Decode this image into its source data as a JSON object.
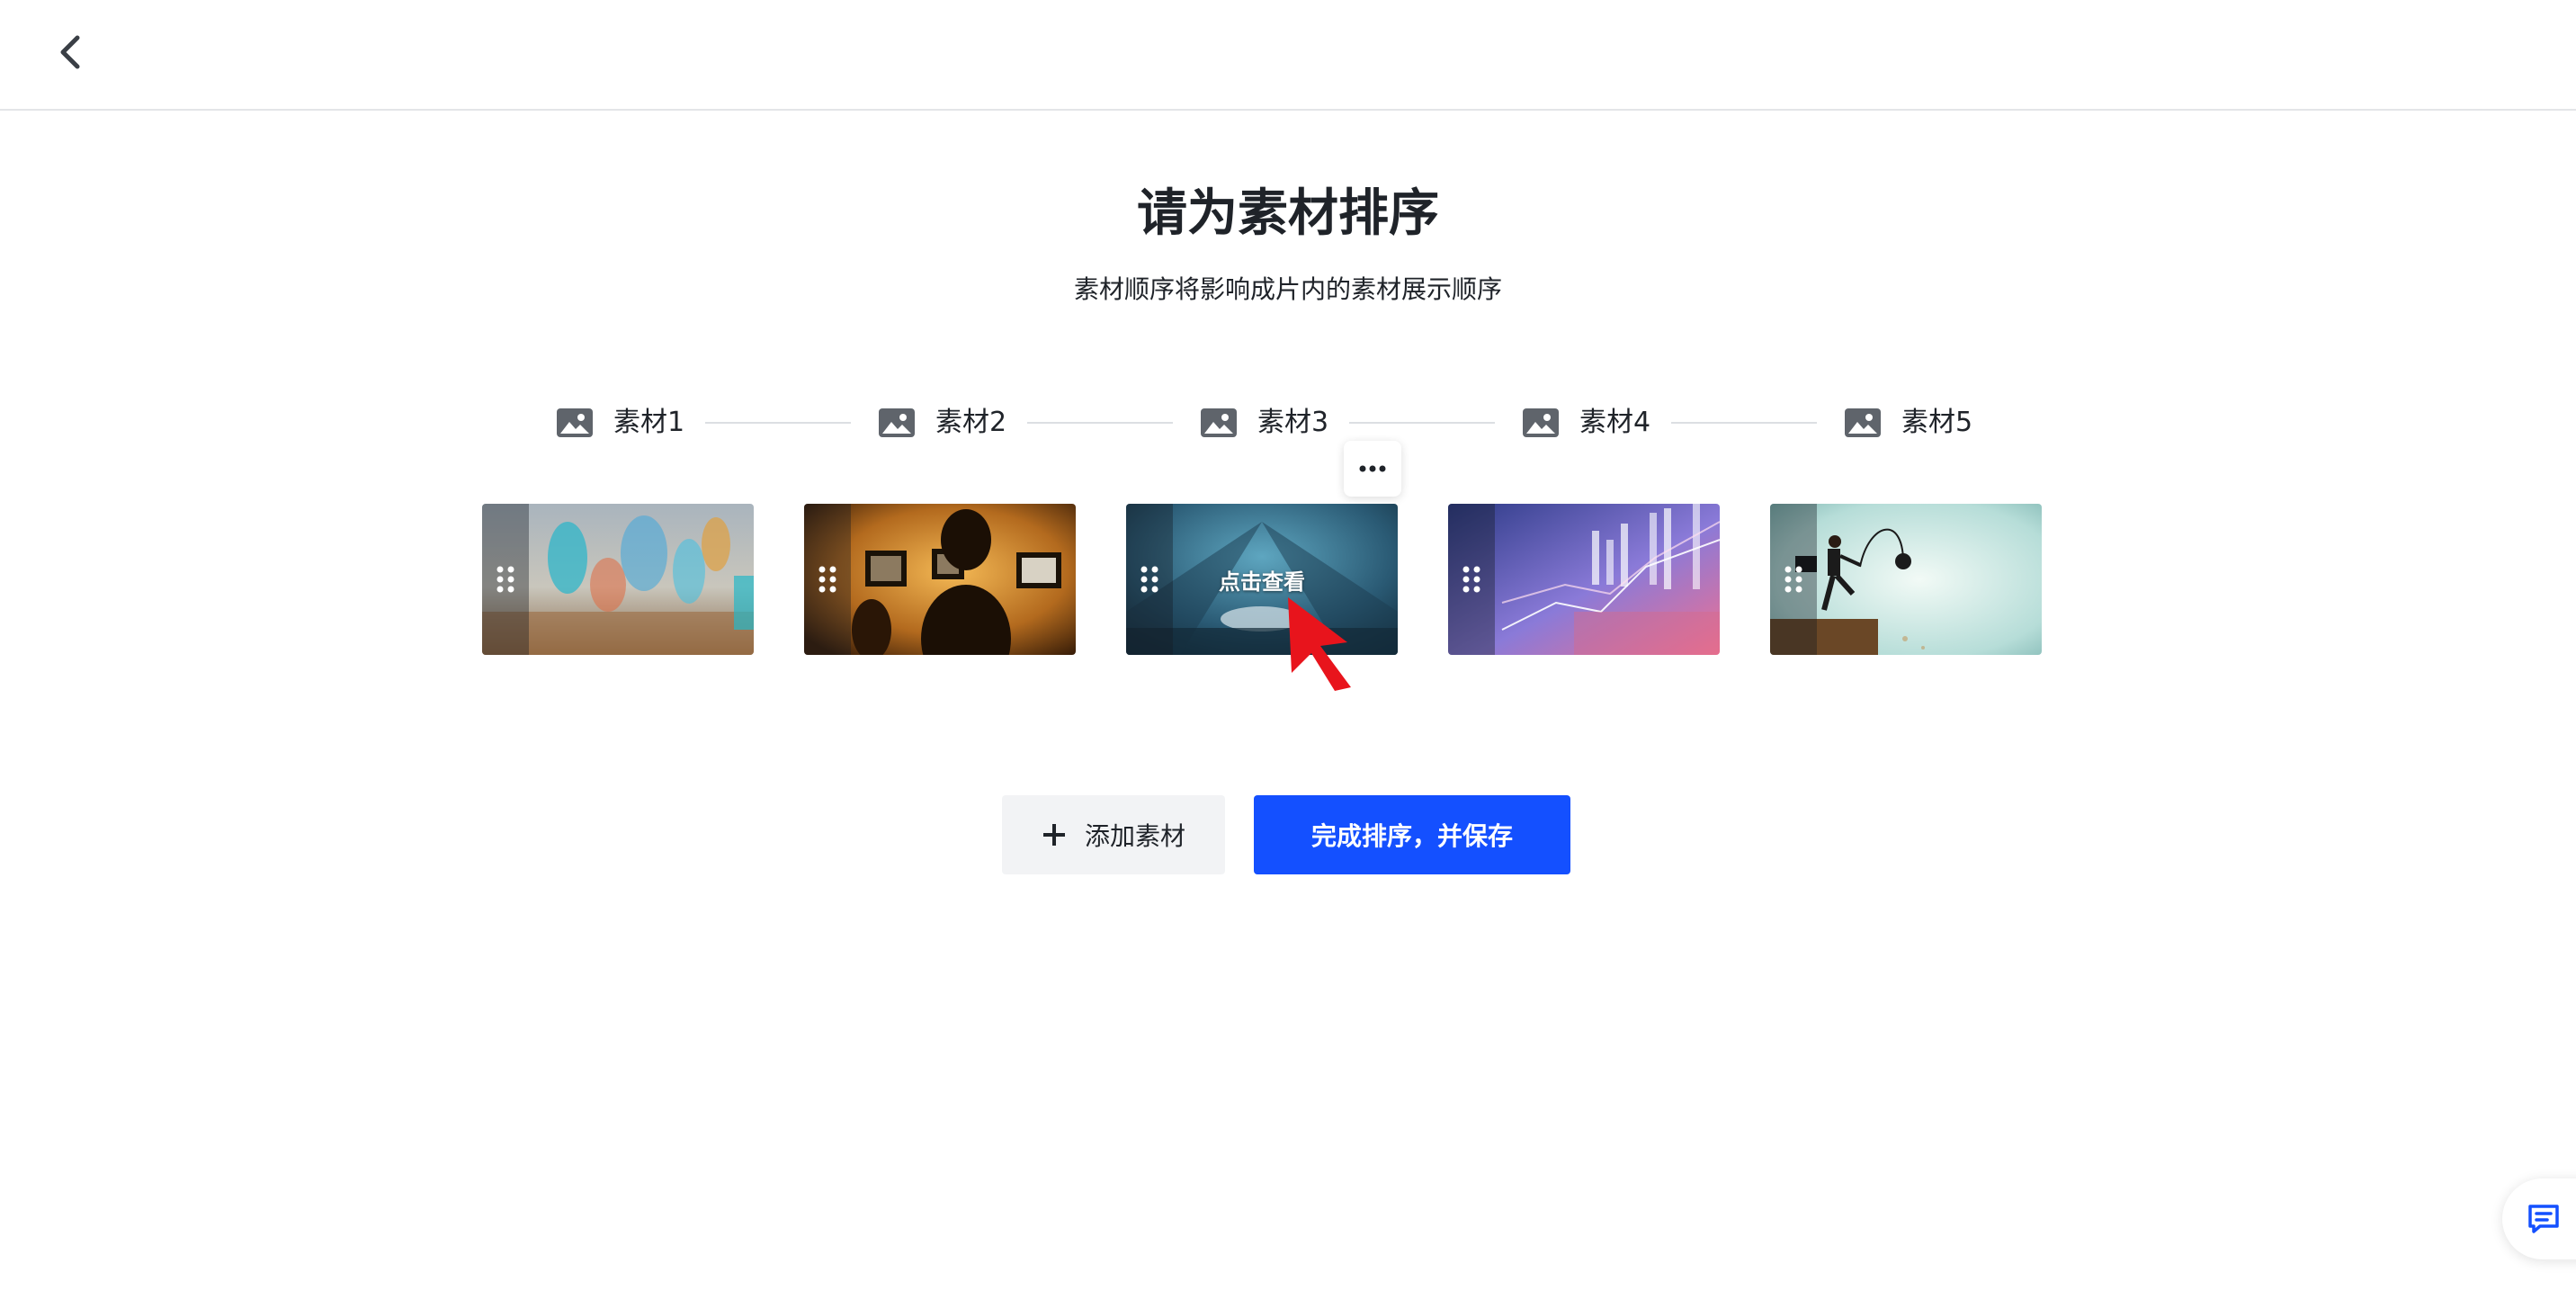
{
  "header": {
    "back_icon": "chevron-left-icon"
  },
  "main": {
    "title": "请为素材排序",
    "subtitle": "素材顺序将影响成片内的素材展示顺序"
  },
  "steps": [
    {
      "label": "素材1",
      "icon": "image-icon"
    },
    {
      "label": "素材2",
      "icon": "image-icon"
    },
    {
      "label": "素材3",
      "icon": "image-icon"
    },
    {
      "label": "素材4",
      "icon": "image-icon"
    },
    {
      "label": "素材5",
      "icon": "image-icon"
    }
  ],
  "cards": [
    {
      "name": "素材1",
      "hover_label": ""
    },
    {
      "name": "素材2",
      "hover_label": ""
    },
    {
      "name": "素材3",
      "hover_label": "点击查看"
    },
    {
      "name": "素材4",
      "hover_label": ""
    },
    {
      "name": "素材5",
      "hover_label": ""
    }
  ],
  "actions": {
    "add_label": "添加素材",
    "save_label": "完成排序，并保存"
  },
  "colors": {
    "primary": "#1450ff",
    "secondary_bg": "#f2f3f5",
    "text": "#1f2329",
    "pointer": "#e8141c"
  }
}
